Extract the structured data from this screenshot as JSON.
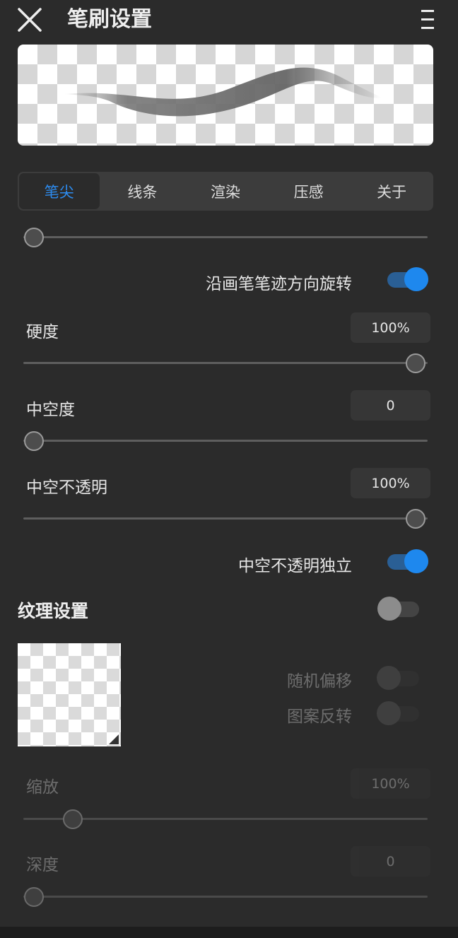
{
  "header": {
    "title": "笔刷设置",
    "close_icon": "close-icon",
    "menu_icon": "menu-icon"
  },
  "tabs": [
    {
      "label": "笔尖",
      "active": true
    },
    {
      "label": "线条",
      "active": false
    },
    {
      "label": "渲染",
      "active": false
    },
    {
      "label": "压感",
      "active": false
    },
    {
      "label": "关于",
      "active": false
    }
  ],
  "settings": {
    "top_slider": {
      "value": 0
    },
    "rotate_toggle": {
      "label": "沿画笔笔迹方向旋转",
      "on": true
    },
    "hardness": {
      "label": "硬度",
      "value": "100%",
      "level": 1.0
    },
    "hollow": {
      "label": "中空度",
      "value": "0",
      "level": 0.0
    },
    "hollow_opacity": {
      "label": "中空不透明",
      "value": "100%",
      "level": 1.0
    },
    "hollow_opacity_independent": {
      "label": "中空不透明独立",
      "on": true
    }
  },
  "texture": {
    "title": "纹理设置",
    "enabled": false,
    "random_offset": {
      "label": "随机偏移",
      "on": false
    },
    "pattern_invert": {
      "label": "图案反转",
      "on": false
    },
    "scale": {
      "label": "缩放",
      "value": "100%",
      "level": 0.12
    },
    "depth": {
      "label": "深度",
      "value": "0",
      "level": 0.0
    }
  },
  "colors": {
    "accent": "#2d8cf0",
    "background": "#2b2b2b",
    "panel": "#3c3c3c"
  }
}
